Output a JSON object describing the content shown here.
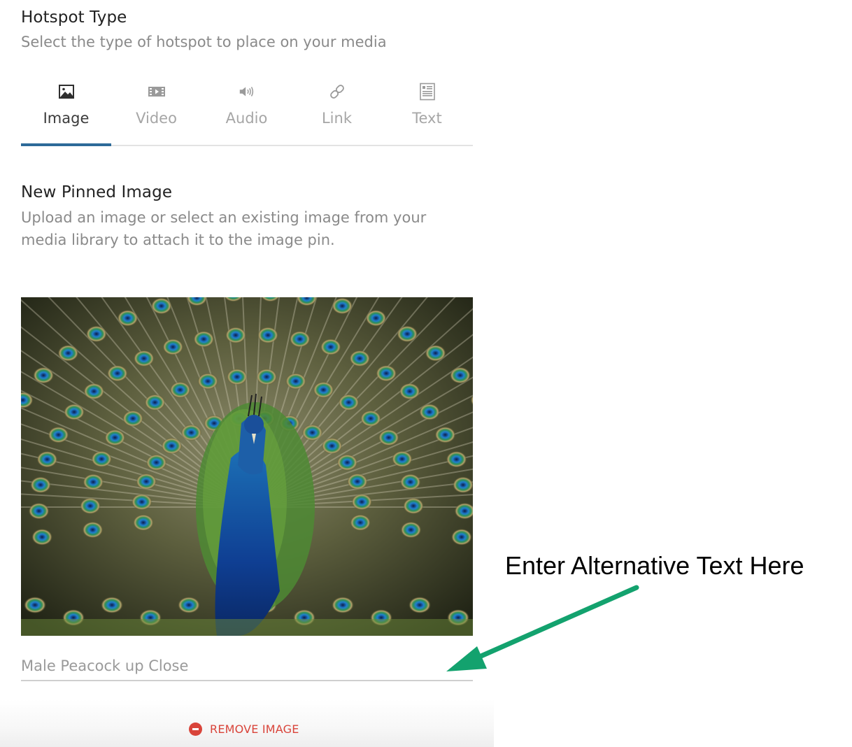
{
  "hotspot": {
    "title": "Hotspot Type",
    "description": "Select the type of hotspot to place on your media"
  },
  "tabs": [
    {
      "label": "Image",
      "icon": "image-icon",
      "active": true
    },
    {
      "label": "Video",
      "icon": "video-icon",
      "active": false
    },
    {
      "label": "Audio",
      "icon": "audio-icon",
      "active": false
    },
    {
      "label": "Link",
      "icon": "link-icon",
      "active": false
    },
    {
      "label": "Text",
      "icon": "text-icon",
      "active": false
    }
  ],
  "pinned": {
    "title": "New Pinned Image",
    "description_line1": "Upload an image or select an existing image from your",
    "description_line2": "media library to attach it to the image pin."
  },
  "alt_text": {
    "value": "Male Peacock up Close"
  },
  "remove": {
    "label": "REMOVE IMAGE",
    "icon": "remove-circle-icon"
  },
  "annotation": {
    "text": "Enter Alternative Text Here",
    "arrow_icon": "arrow-icon"
  },
  "colors": {
    "accent": "#2d6a99",
    "danger": "#d9443a",
    "arrow": "#13a26e"
  }
}
